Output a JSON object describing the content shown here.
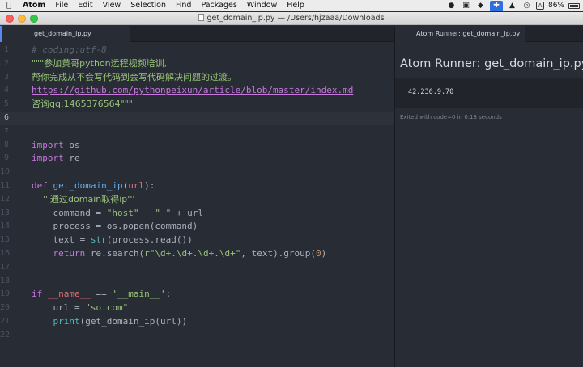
{
  "menubar": {
    "items": [
      "Atom",
      "File",
      "Edit",
      "View",
      "Selection",
      "Find",
      "Packages",
      "Window",
      "Help"
    ],
    "battery": "86%",
    "lang": "A"
  },
  "window": {
    "title": "get_domain_ip.py — /Users/hjzaaa/Downloads"
  },
  "editor": {
    "tab_label": "get_domain_ip.py",
    "active_line": 6
  },
  "runner": {
    "tab_label": "Atom Runner: get_domain_ip.py",
    "title": "Atom Runner: get_domain_ip.py",
    "output": "42.236.9.70",
    "status": "Exited with code=0 in 0.13 seconds"
  },
  "code_lines": [
    [
      {
        "t": "# coding:utf-8",
        "c": "c-comment"
      }
    ],
    [
      {
        "t": "\"\"\"参加黄哥python远程视频培训,",
        "c": "c-string"
      }
    ],
    [
      {
        "t": "帮你完成从不会写代码到会写代码解决问题的过渡。",
        "c": "c-string"
      }
    ],
    [
      {
        "t": "https://github.com/pythonpeixun/article/blob/master/index.md",
        "c": "c-link"
      }
    ],
    [
      {
        "t": "咨询qq:1465376564\"\"\"",
        "c": "c-string"
      }
    ],
    [],
    [],
    [
      {
        "t": "import",
        "c": "c-kw"
      },
      {
        "t": " os",
        "c": "c-op"
      }
    ],
    [
      {
        "t": "import",
        "c": "c-kw"
      },
      {
        "t": " re",
        "c": "c-op"
      }
    ],
    [],
    [
      {
        "t": "def",
        "c": "c-kw"
      },
      {
        "t": " ",
        "c": "c-op"
      },
      {
        "t": "get_domain_ip",
        "c": "c-fn"
      },
      {
        "t": "(",
        "c": "c-op"
      },
      {
        "t": "url",
        "c": "c-param"
      },
      {
        "t": "):",
        "c": "c-op"
      }
    ],
    [
      {
        "t": "    '''通过domain取得ip'''",
        "c": "c-string"
      }
    ],
    [
      {
        "t": "    command = ",
        "c": "c-op"
      },
      {
        "t": "\"host\"",
        "c": "c-string"
      },
      {
        "t": " + ",
        "c": "c-op"
      },
      {
        "t": "\" \"",
        "c": "c-string"
      },
      {
        "t": " + url",
        "c": "c-op"
      }
    ],
    [
      {
        "t": "    process = os.popen(command)",
        "c": "c-op"
      }
    ],
    [
      {
        "t": "    text = ",
        "c": "c-op"
      },
      {
        "t": "str",
        "c": "c-builtin"
      },
      {
        "t": "(process.read())",
        "c": "c-op"
      }
    ],
    [
      {
        "t": "    ",
        "c": "c-op"
      },
      {
        "t": "return",
        "c": "c-kw"
      },
      {
        "t": " re.search(",
        "c": "c-op"
      },
      {
        "t": "r\"\\d+.\\d+.\\d+.\\d+\"",
        "c": "c-string"
      },
      {
        "t": ", text).group(",
        "c": "c-op"
      },
      {
        "t": "0",
        "c": "c-num"
      },
      {
        "t": ")",
        "c": "c-op"
      }
    ],
    [],
    [],
    [
      {
        "t": "if",
        "c": "c-kw"
      },
      {
        "t": " ",
        "c": "c-op"
      },
      {
        "t": "__name__",
        "c": "c-var"
      },
      {
        "t": " == ",
        "c": "c-op"
      },
      {
        "t": "'__main__'",
        "c": "c-string"
      },
      {
        "t": ":",
        "c": "c-op"
      }
    ],
    [
      {
        "t": "    url = ",
        "c": "c-op"
      },
      {
        "t": "\"so.com\"",
        "c": "c-string"
      }
    ],
    [
      {
        "t": "    ",
        "c": "c-op"
      },
      {
        "t": "print",
        "c": "c-builtin"
      },
      {
        "t": "(get_domain_ip(url))",
        "c": "c-op"
      }
    ],
    []
  ]
}
